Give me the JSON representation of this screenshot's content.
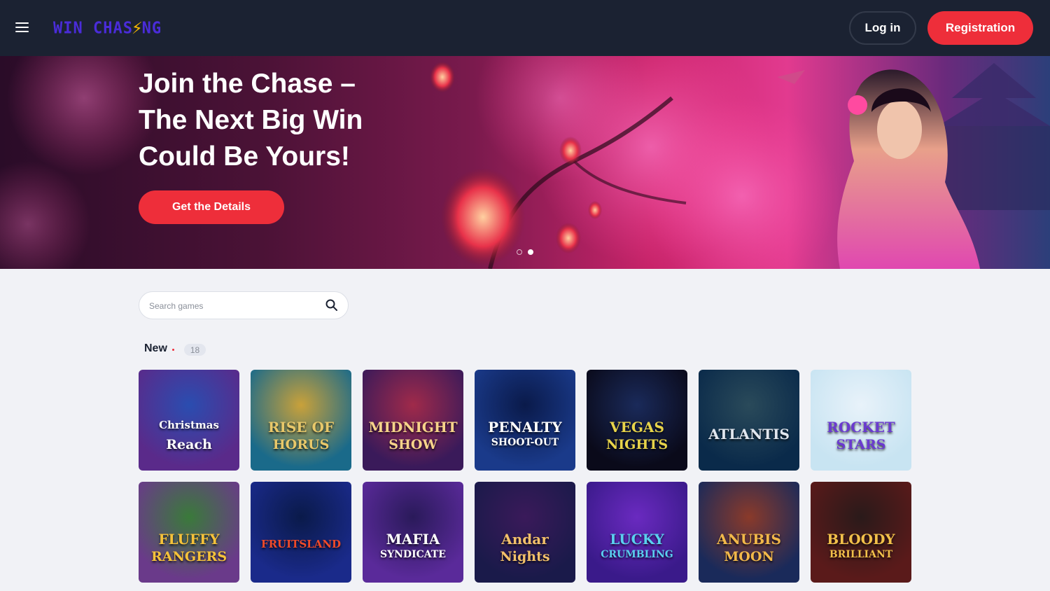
{
  "header": {
    "logo_text_left": "WIN CHAS",
    "logo_text_right": "NG",
    "login_label": "Log in",
    "registration_label": "Registration"
  },
  "hero": {
    "title_line1": "Join the Chase –",
    "title_line2": "The Next Big Win",
    "title_line3": "Could Be Yours!",
    "cta_label": "Get the Details",
    "slides": 2,
    "active_slide": 2
  },
  "search": {
    "placeholder": "Search games"
  },
  "section": {
    "title": "New",
    "count": "18"
  },
  "games": [
    {
      "line1": "Christmas",
      "line2": "Reach",
      "color_a": "#5a2a8a",
      "color_b": "#2a4db0",
      "text_color": "#ffffff"
    },
    {
      "line1": "RISE OF",
      "line2": "HORUS",
      "color_a": "#1a6a8a",
      "color_b": "#c9a13a",
      "text_color": "#e8c86a"
    },
    {
      "line1": "MIDNIGHT",
      "line2": "SHOW",
      "color_a": "#3a1a5a",
      "color_b": "#a02a4a",
      "text_color": "#f7d38a"
    },
    {
      "line1": "PENALTY",
      "line2": "SHOOT-OUT",
      "color_a": "#1a3a8a",
      "color_b": "#0a1a4a",
      "text_color": "#ffffff"
    },
    {
      "line1": "VEGAS",
      "line2": "NIGHTS",
      "color_a": "#0a0a1a",
      "color_b": "#1a2a5a",
      "text_color": "#e8d44a"
    },
    {
      "line1": "ATLANTIS",
      "line2": "",
      "color_a": "#0a2a4a",
      "color_b": "#2a4a5a",
      "text_color": "#e0e6ee"
    },
    {
      "line1": "ROCKET",
      "line2": "STARS",
      "color_a": "#c8e4f2",
      "color_b": "#e8f2fa",
      "text_color": "#6a3ad0"
    },
    {
      "line1": "FLUFFY",
      "line2": "RANGERS",
      "color_a": "#6a3a8a",
      "color_b": "#3a7a3a",
      "text_color": "#f5c23a"
    },
    {
      "line1": "FRUITSLAND",
      "line2": "",
      "color_a": "#1a2a8a",
      "color_b": "#0a1a4a",
      "text_color": "#f04a2a"
    },
    {
      "line1": "MAFIA",
      "line2": "SYNDICATE",
      "color_a": "#5a2a9a",
      "color_b": "#2a1a5a",
      "text_color": "#ffffff"
    },
    {
      "line1": "Andar",
      "line2": "Nights",
      "color_a": "#1a1a4a",
      "color_b": "#3a1a5a",
      "text_color": "#f2c06a"
    },
    {
      "line1": "LUCKY",
      "line2": "CRUMBLING",
      "color_a": "#3a1a8a",
      "color_b": "#6a2ac0",
      "text_color": "#5ad0f0"
    },
    {
      "line1": "ANUBIS",
      "line2": "MOON",
      "color_a": "#1a2a5a",
      "color_b": "#8a3a2a",
      "text_color": "#f2b84a"
    },
    {
      "line1": "BLOODY",
      "line2": "BRILLIANT",
      "color_a": "#5a1a1a",
      "color_b": "#2a1a1a",
      "text_color": "#f2c04a"
    }
  ]
}
